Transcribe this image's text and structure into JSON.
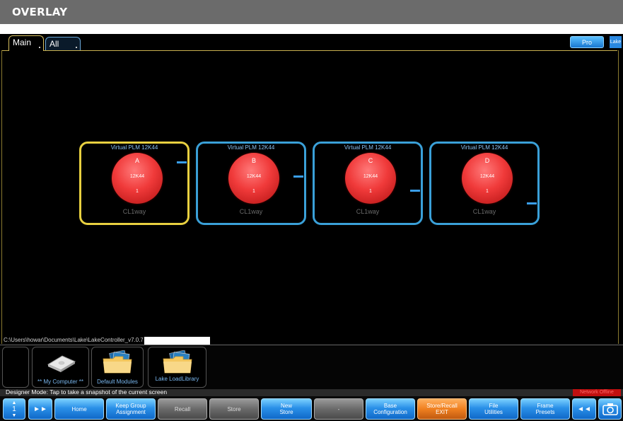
{
  "banner": {
    "title": "OVERLAY"
  },
  "tabs": [
    {
      "label": "Main",
      "active": true
    },
    {
      "label": "All",
      "active": false
    }
  ],
  "top_right": {
    "pro_label": "Pro",
    "lake_label": "Lake"
  },
  "modules": [
    {
      "title": "Virtual PLM 12K44",
      "letter": "A",
      "model": "12K44",
      "number": "1",
      "config": "CL1way",
      "selected": true
    },
    {
      "title": "Virtual PLM 12K44",
      "letter": "B",
      "model": "12K44",
      "number": "1",
      "config": "CL1way",
      "selected": false
    },
    {
      "title": "Virtual PLM 12K44",
      "letter": "C",
      "model": "12K44",
      "number": "1",
      "config": "CL1way",
      "selected": false
    },
    {
      "title": "Virtual PLM 12K44",
      "letter": "D",
      "model": "12K44",
      "number": "1",
      "config": "CL1way",
      "selected": false
    }
  ],
  "path": "C:\\Users\\howar\\Documents\\Lake\\LakeController_v7.0.7",
  "browser": {
    "items": [
      {
        "label": "** My Computer **",
        "icon": "hard-drive-icon"
      },
      {
        "label": "Default Modules",
        "icon": "folder-icon"
      },
      {
        "label": "Lake LoadLibrary",
        "icon": "folder-icon"
      }
    ]
  },
  "status": {
    "text": "Designer Mode: Tap to take a snapshot of the current screen",
    "network": "Network Offline"
  },
  "toolbar": {
    "page_number": "1",
    "buttons": [
      {
        "label": "Home",
        "style": "blue"
      },
      {
        "label": "Keep Group\nAssignment",
        "style": "blue"
      },
      {
        "label": "Recall",
        "style": "gray"
      },
      {
        "label": "Store",
        "style": "gray"
      },
      {
        "label": "New\nStore",
        "style": "blue"
      },
      {
        "label": "-",
        "style": "gray"
      },
      {
        "label": "Base\nConfiguration",
        "style": "blue"
      },
      {
        "label": "Store/Recall\nEXIT",
        "style": "orange"
      },
      {
        "label": "File\nUtilities",
        "style": "blue"
      },
      {
        "label": "Frame\nPresets",
        "style": "blue"
      }
    ]
  },
  "colors": {
    "selected_border": "#e8d040",
    "module_border": "#3aa0d8",
    "accent_blue": "#2a90e8",
    "exit_orange": "#f08020"
  }
}
